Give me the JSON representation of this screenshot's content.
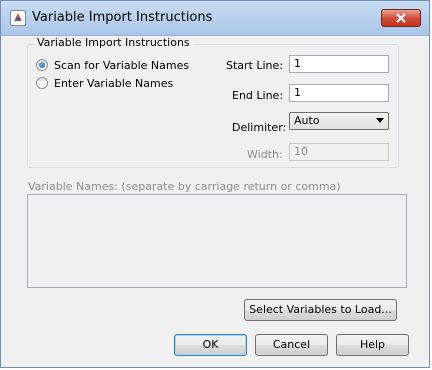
{
  "window": {
    "title": "Variable Import Instructions"
  },
  "group": {
    "label": "Variable Import Instructions"
  },
  "options": {
    "scan_label": "Scan for Variable Names",
    "enter_label": "Enter Variable Names",
    "selected": "scan"
  },
  "fields": {
    "start_line_label": "Start Line:",
    "start_line_value": "1",
    "end_line_label": "End Line:",
    "end_line_value": "1",
    "delimiter_label": "Delimiter:",
    "delimiter_value": "Auto",
    "width_label": "Width:",
    "width_value": "10"
  },
  "variable_names": {
    "label": "Variable Names: (separate by carriage return or comma)",
    "value": ""
  },
  "buttons": {
    "select_vars": "Select Variables to Load...",
    "ok": "OK",
    "cancel": "Cancel",
    "help": "Help"
  }
}
